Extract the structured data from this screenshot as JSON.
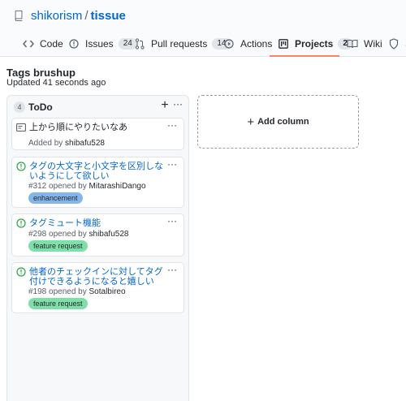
{
  "repo": {
    "owner": "shikorism",
    "separator": "/",
    "name": "tissue"
  },
  "tabs": [
    {
      "label": "Code",
      "icon": "code-icon"
    },
    {
      "label": "Issues",
      "count": "24",
      "icon": "issue-opened-icon"
    },
    {
      "label": "Pull requests",
      "count": "14",
      "icon": "git-pull-request-icon"
    },
    {
      "label": "Actions",
      "icon": "play-icon"
    },
    {
      "label": "Projects",
      "count": "2",
      "icon": "project-icon",
      "selected": true
    },
    {
      "label": "Wiki",
      "icon": "book-icon"
    },
    {
      "label": "S",
      "icon": "shield-icon"
    }
  ],
  "project": {
    "name": "Tags brushup",
    "updated": "Updated 41 seconds ago"
  },
  "column": {
    "count": "4",
    "title": "ToDo",
    "add_symbol": "+",
    "more_symbol": "···",
    "cards": [
      {
        "type": "note",
        "title": "上から順にやりたいなあ",
        "meta_prefix": "Added by ",
        "user": "shibafu528"
      },
      {
        "type": "issue",
        "title": "タグの大文字と小文字を区別しないようにして欲しい",
        "meta_prefix": "#312 opened by ",
        "user": "MitarashiDango",
        "label": "enhancement",
        "label_color": "#84b6eb"
      },
      {
        "type": "issue",
        "title": "タグミュート機能",
        "meta_prefix": "#298 opened by ",
        "user": "shibafu528",
        "label": "feature request",
        "label_color": "#7ee0a8"
      },
      {
        "type": "issue",
        "title": "他者のチェックインに対してタグ付けできるようになると嬉しい",
        "meta_prefix": "#198 opened by ",
        "user": "Sotalbireo",
        "label": "feature request",
        "label_color": "#7ee0a8"
      }
    ]
  },
  "add_column": {
    "label": "Add column",
    "symbol": "+"
  },
  "colors": {
    "link": "#0366d6",
    "accent_underline": "#f9826c",
    "issue_open": "#28a745"
  }
}
